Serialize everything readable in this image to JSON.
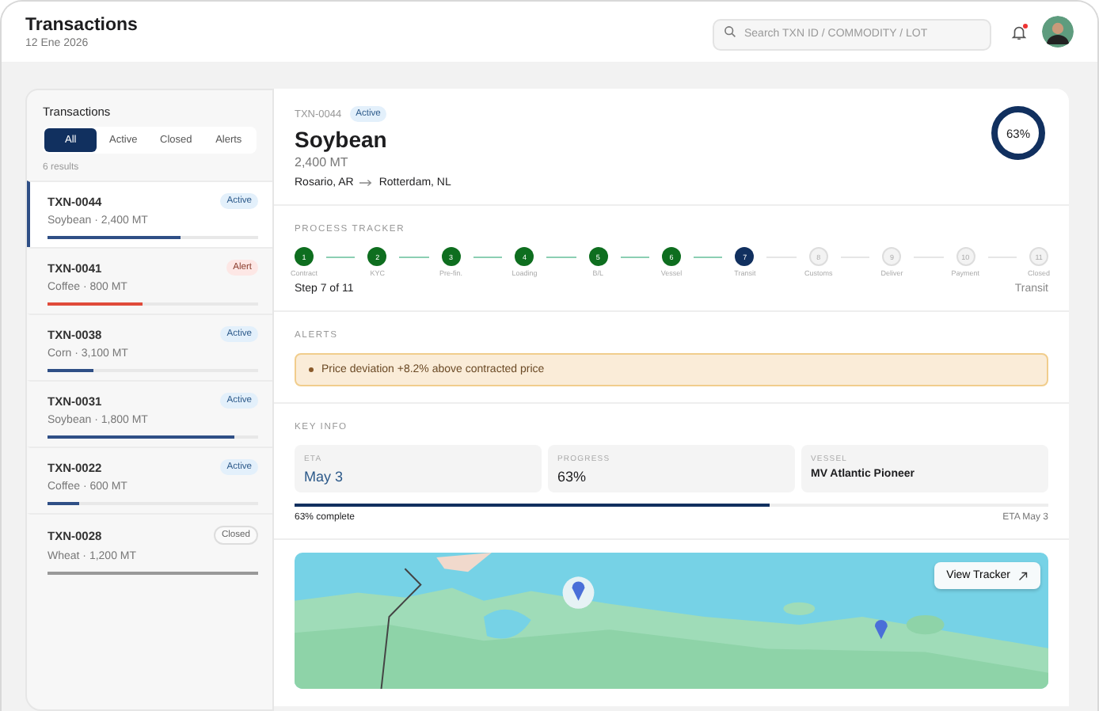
{
  "header": {
    "title": "Transactions",
    "date": "12 Ene 2026",
    "search": {
      "placeholder": "Search TXN ID / COMMODITY / LOT"
    },
    "notifications_unread": true
  },
  "sidebar": {
    "title": "Transactions",
    "filters": [
      {
        "label": "All",
        "selected": true
      },
      {
        "label": "Active",
        "selected": false
      },
      {
        "label": "Closed",
        "selected": false
      },
      {
        "label": "Alerts",
        "selected": false
      }
    ],
    "result_count": "6 results",
    "items": [
      {
        "id": "TXN-0044",
        "status": {
          "label": "Active",
          "kind": "active"
        },
        "detail": "Soybean · 2,400 MT",
        "level": 0.63,
        "selected": true
      },
      {
        "id": "TXN-0041",
        "status": {
          "label": "Alert",
          "kind": "alert"
        },
        "detail": "Coffee · 800 MT",
        "level": 0.45,
        "selected": false
      },
      {
        "id": "TXN-0038",
        "status": {
          "label": "Active",
          "kind": "active"
        },
        "detail": "Corn · 3,100 MT",
        "level": 0.22,
        "selected": false
      },
      {
        "id": "TXN-0031",
        "status": {
          "label": "Active",
          "kind": "active"
        },
        "detail": "Soybean · 1,800 MT",
        "level": 0.89,
        "selected": false
      },
      {
        "id": "TXN-0022",
        "status": {
          "label": "Active",
          "kind": "active"
        },
        "detail": "Coffee · 600 MT",
        "level": 0.15,
        "selected": false
      },
      {
        "id": "TXN-0028",
        "status": {
          "label": "Closed",
          "kind": "closed"
        },
        "detail": "Wheat · 1,200 MT",
        "level": 1,
        "selected": false
      }
    ]
  },
  "detail": {
    "id": "TXN-0044",
    "status": {
      "label": "Active",
      "kind": "active"
    },
    "commodity": "Soybean",
    "quantity": "2,400 MT",
    "origin": "Rosario, AR",
    "destination": "Rotterdam, NL",
    "progress_ring": "63%",
    "tracker": {
      "title": "PROCESS TRACKER",
      "steps": [
        {
          "number": "1",
          "label": "Contract",
          "completed": true,
          "current": false
        },
        {
          "number": "2",
          "label": "KYC",
          "completed": true,
          "current": false
        },
        {
          "number": "3",
          "label": "Pre-fin.",
          "completed": true,
          "current": false
        },
        {
          "number": "4",
          "label": "Loading",
          "completed": true,
          "current": false
        },
        {
          "number": "5",
          "label": "B/L",
          "completed": true,
          "current": false
        },
        {
          "number": "6",
          "label": "Vessel",
          "completed": true,
          "current": false
        },
        {
          "number": "7",
          "label": "Transit",
          "completed": false,
          "current": true
        },
        {
          "number": "8",
          "label": "Customs",
          "completed": false,
          "current": false
        },
        {
          "number": "9",
          "label": "Deliver",
          "completed": false,
          "current": false
        },
        {
          "number": "10",
          "label": "Payment",
          "completed": false,
          "current": false
        },
        {
          "number": "11",
          "label": "Closed",
          "completed": false,
          "current": false
        }
      ],
      "step_text": "Step 7 of 11",
      "stage": "Transit"
    },
    "alerts": {
      "title": "ALERTS",
      "items": [
        {
          "text": "Price deviation +8.2% above contracted price"
        }
      ]
    },
    "key_info": {
      "title": "KEY INFO",
      "cards": [
        {
          "label": "ETA",
          "value": "May 3",
          "kind": "date"
        },
        {
          "label": "PROGRESS",
          "value": "63%",
          "kind": "percent"
        },
        {
          "label": "VESSEL",
          "value": "MV Atlantic Pioneer",
          "kind": "text"
        }
      ],
      "level": 0.63,
      "caption": "63% complete",
      "eta_text": "ETA May 3"
    },
    "map": {
      "kind": "picture",
      "button": "View Tracker"
    }
  }
}
